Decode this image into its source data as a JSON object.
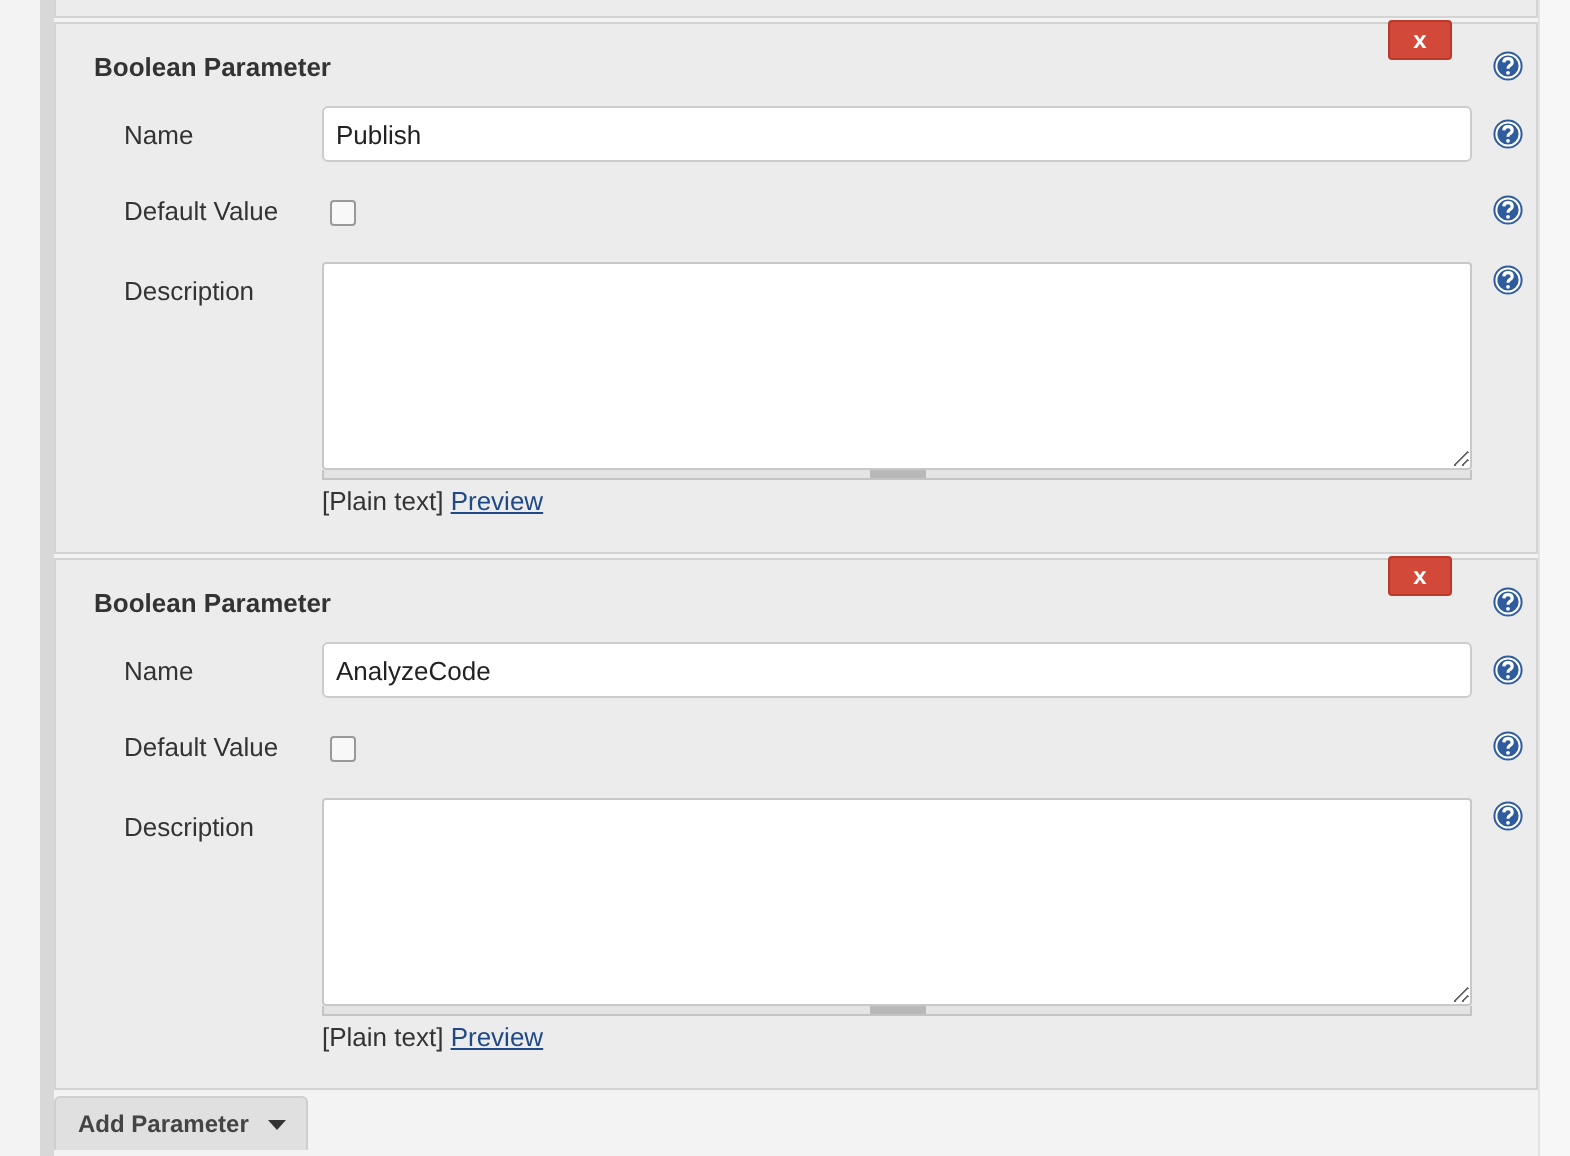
{
  "parameters": [
    {
      "title": "Boolean Parameter",
      "delete_label": "x",
      "name_label": "Name",
      "name_value": "Publish",
      "default_label": "Default Value",
      "default_checked": false,
      "description_label": "Description",
      "format_note": "[Plain text]",
      "preview_link": "Preview"
    },
    {
      "title": "Boolean Parameter",
      "delete_label": "x",
      "name_label": "Name",
      "name_value": "AnalyzeCode",
      "default_label": "Default Value",
      "default_checked": false,
      "description_label": "Description",
      "format_note": "[Plain text]",
      "preview_link": "Preview"
    }
  ],
  "add_button": {
    "label": "Add Parameter"
  }
}
